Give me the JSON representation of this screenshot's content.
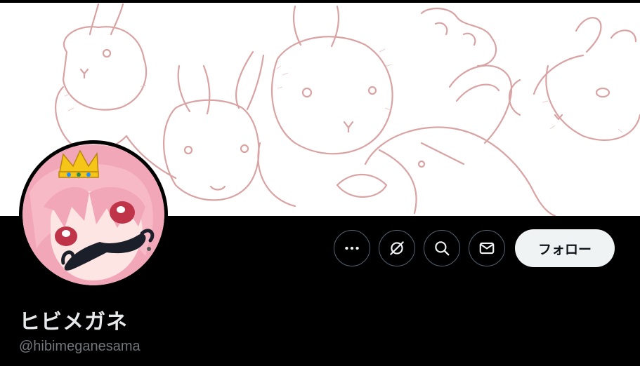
{
  "profile": {
    "display_name": "ヒビメガネ",
    "handle": "@hibimeganesama"
  },
  "actions": {
    "more_icon": "more-dots-icon",
    "grok_icon": "grok-icon",
    "search_icon": "search-icon",
    "message_icon": "mail-icon",
    "follow_label": "フォロー"
  },
  "colors": {
    "background": "#000000",
    "banner_line": "#d9a3a3",
    "follow_bg": "#eff3f4",
    "handle_text": "#71767b",
    "border": "#536471"
  }
}
